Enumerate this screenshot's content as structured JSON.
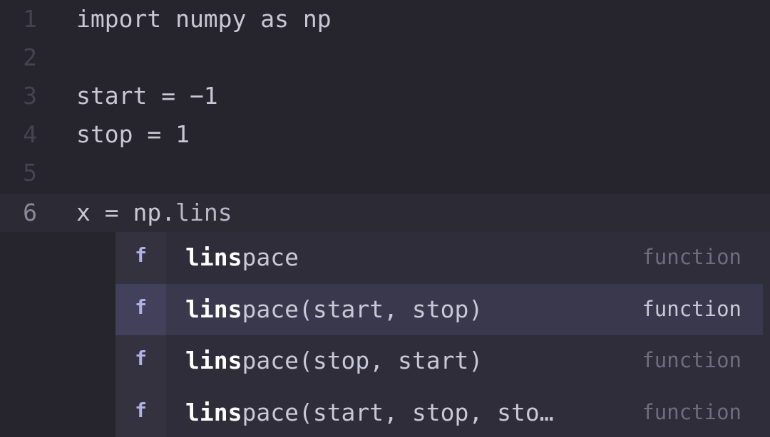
{
  "editor": {
    "lines": [
      {
        "number": "1",
        "text": "import numpy as np"
      },
      {
        "number": "2",
        "text": ""
      },
      {
        "number": "3",
        "text": "start = −1"
      },
      {
        "number": "4",
        "text": "stop = 1"
      },
      {
        "number": "5",
        "text": ""
      },
      {
        "number": "6",
        "before": "x = np",
        "dot": ".",
        "partial": "lins"
      }
    ]
  },
  "autocomplete": {
    "items": [
      {
        "kind_icon": "f",
        "match": "lins",
        "rest": "pace",
        "type": "function"
      },
      {
        "kind_icon": "f",
        "match": "lins",
        "rest": "pace(start, stop)",
        "type": "function"
      },
      {
        "kind_icon": "f",
        "match": "lins",
        "rest": "pace(stop, start)",
        "type": "function"
      },
      {
        "kind_icon": "f",
        "match": "lins",
        "rest": "pace(start, stop, sto…",
        "type": "function"
      }
    ]
  }
}
